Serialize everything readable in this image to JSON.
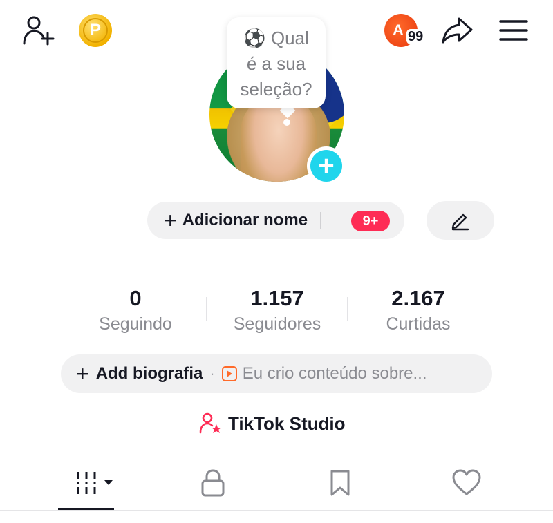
{
  "top_bar": {
    "add_friend_icon": "person-plus-icon",
    "coins_letter": "P",
    "notification_avatar_letter": "A",
    "notification_count": "99",
    "share_icon": "share-arrow-icon",
    "menu_icon": "hamburger-menu-icon"
  },
  "question_bubble": {
    "emoji": "⚽",
    "line1": "Qual",
    "line2": "é a sua",
    "line3": "seleção?"
  },
  "profile": {
    "add_name_label": "Adicionar nome",
    "add_name_badge": "9+",
    "edit_icon": "pencil-icon"
  },
  "stats": [
    {
      "value": "0",
      "label": "Seguindo"
    },
    {
      "value": "1.157",
      "label": "Seguidores"
    },
    {
      "value": "2.167",
      "label": "Curtidas"
    }
  ],
  "bio": {
    "add_label": "Add biografia",
    "separator": "·",
    "hint": "Eu crio conteúdo sobre..."
  },
  "studio": {
    "label": "TikTok Studio"
  },
  "tabs": [
    {
      "name": "videos-grid",
      "icon": "grid-icon"
    },
    {
      "name": "private",
      "icon": "lock-icon"
    },
    {
      "name": "saved",
      "icon": "bookmark-icon"
    },
    {
      "name": "liked",
      "icon": "heart-icon"
    }
  ],
  "colors": {
    "accent_red": "#fe2c55",
    "cyan": "#20d5ec",
    "coin_gold": "#f2b200",
    "text_dark": "#161823",
    "text_gray": "#8a8b91",
    "pill_bg": "#f1f1f2"
  }
}
